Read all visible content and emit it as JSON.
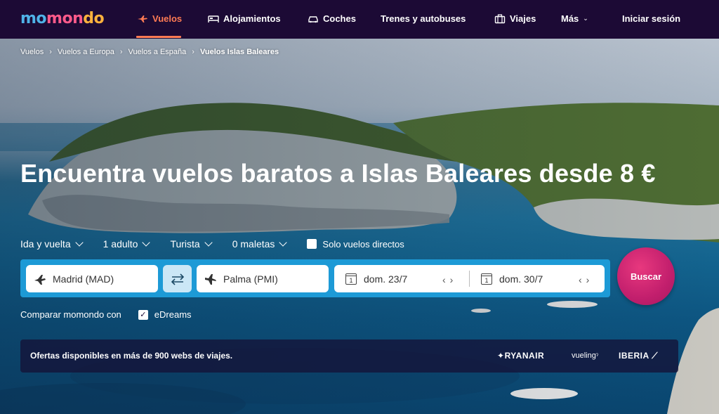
{
  "header": {
    "logo": {
      "part1": "mo",
      "part2": "mon",
      "part3": "do"
    },
    "nav": [
      {
        "label": "Vuelos",
        "icon": "plane-icon",
        "active": true
      },
      {
        "label": "Alojamientos",
        "icon": "bed-icon"
      },
      {
        "label": "Coches",
        "icon": "car-icon"
      },
      {
        "label": "Trenes y autobuses"
      },
      {
        "label": "Viajes",
        "icon": "suitcase-icon"
      },
      {
        "label": "Más"
      }
    ],
    "login": "Iniciar sesión"
  },
  "breadcrumb": [
    "Vuelos",
    "Vuelos a Europa",
    "Vuelos a España",
    "Vuelos Islas Baleares"
  ],
  "hero": {
    "title": "Encuentra vuelos baratos a Islas Baleares desde 8 €"
  },
  "options": {
    "trip_type": "Ida y vuelta",
    "passengers": "1 adulto",
    "cabin": "Turista",
    "bags": "0 maletas",
    "direct_only": "Solo vuelos directos"
  },
  "search": {
    "origin": "Madrid (MAD)",
    "destination": "Palma (PMI)",
    "depart": "dom. 23/7",
    "return": "dom. 30/7",
    "calendar_day": "1",
    "button": "Buscar"
  },
  "compare": {
    "label": "Comparar momondo con",
    "partner": "eDreams",
    "partner_checked": true
  },
  "offers": {
    "text": "Ofertas disponibles en más de 900 webs de viajes.",
    "brands": [
      "RYANAIR",
      "vueling",
      "IBERIA"
    ]
  },
  "colors": {
    "nav_bg": "#1c0a35",
    "active": "#ff7b54",
    "search_bar": "#1d9ad6",
    "buscar": "#c21f6d"
  }
}
